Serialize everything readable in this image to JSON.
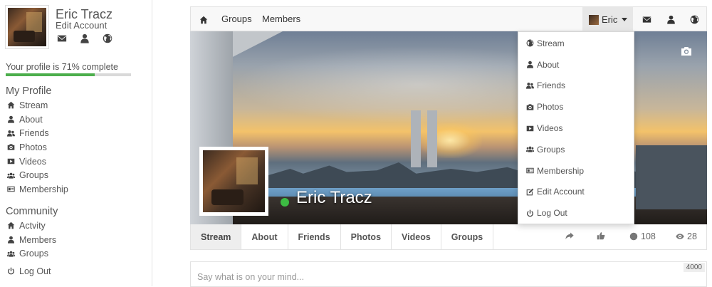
{
  "sidebar": {
    "user_name": "Eric Tracz",
    "edit_account": "Edit Account",
    "mini_icons": [
      "envelope-icon",
      "user-icon",
      "globe-icon"
    ],
    "progress": {
      "text": "Your profile is 71% complete",
      "percent": 71
    },
    "my_profile": {
      "title": "My Profile",
      "items": [
        {
          "label": "Stream",
          "icon": "home-icon"
        },
        {
          "label": "About",
          "icon": "user-icon"
        },
        {
          "label": "Friends",
          "icon": "friends-icon"
        },
        {
          "label": "Photos",
          "icon": "camera-icon"
        },
        {
          "label": "Videos",
          "icon": "video-icon"
        },
        {
          "label": "Groups",
          "icon": "groups-icon"
        },
        {
          "label": "Membership",
          "icon": "membership-icon"
        }
      ]
    },
    "community": {
      "title": "Community",
      "items": [
        {
          "label": "Actvity",
          "icon": "home-icon"
        },
        {
          "label": "Members",
          "icon": "user-icon"
        },
        {
          "label": "Groups",
          "icon": "groups-icon"
        },
        {
          "label": "Log Out",
          "icon": "power-icon"
        }
      ]
    }
  },
  "topnav": {
    "links": [
      "Groups",
      "Members"
    ],
    "user_label": "Eric"
  },
  "cover": {
    "name": "Eric Tracz"
  },
  "dropdown": {
    "items": [
      "Stream",
      "About",
      "Friends",
      "Photos",
      "Videos",
      "Groups",
      "Membership",
      "Edit Account",
      "Log Out"
    ]
  },
  "tabs": [
    "Stream",
    "About",
    "Friends",
    "Photos",
    "Videos",
    "Groups"
  ],
  "stats": {
    "comments": "108",
    "views": "28"
  },
  "status": {
    "placeholder": "Say what is on your mind...",
    "char_limit": "4000"
  },
  "colors": {
    "progress": "#4cae4c",
    "online": "#3dbb43",
    "accent_nav": "#e7e7e7"
  }
}
